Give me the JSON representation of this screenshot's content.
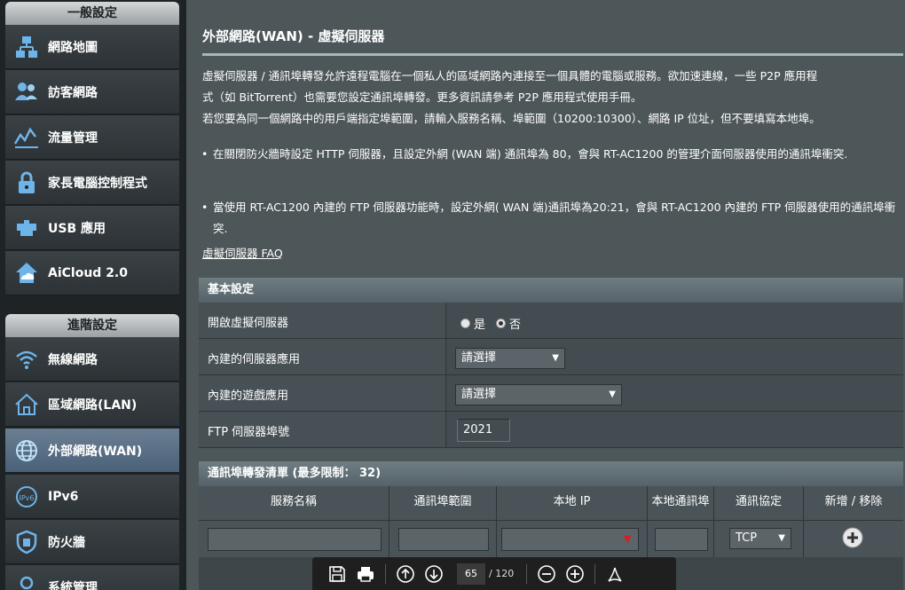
{
  "sidebar": {
    "general_header": "一般設定",
    "advanced_header": "進階設定",
    "general_items": [
      {
        "label": "網路地圖",
        "icon": "network-map-icon"
      },
      {
        "label": "訪客網路",
        "icon": "guest-network-icon"
      },
      {
        "label": "流量管理",
        "icon": "traffic-manager-icon"
      },
      {
        "label": "家長電腦控制程式",
        "icon": "parental-control-icon"
      },
      {
        "label": "USB 應用",
        "icon": "usb-app-icon"
      },
      {
        "label": "AiCloud 2.0",
        "icon": "aicloud-icon"
      }
    ],
    "advanced_items": [
      {
        "label": "無線網路",
        "icon": "wireless-icon"
      },
      {
        "label": "區域網路(LAN)",
        "icon": "lan-icon"
      },
      {
        "label": "外部網路(WAN)",
        "icon": "wan-icon",
        "active": true
      },
      {
        "label": "IPv6",
        "icon": "ipv6-icon"
      },
      {
        "label": "防火牆",
        "icon": "firewall-icon"
      },
      {
        "label": "系統管理",
        "icon": "admin-icon"
      }
    ]
  },
  "main": {
    "title": "外部網路(WAN) - 虛擬伺服器",
    "intro_line1": "虛擬伺服器 / 通訊埠轉發允許遠程電腦在一個私人的區域網路內連接至一個具體的電腦或服務。欲加速連線，一些 P2P 應用程",
    "intro_line2": "式（如 BitTorrent）也需要您設定通訊埠轉發。更多資訊請參考 P2P 應用程式使用手冊。",
    "intro_line3": "若您要為同一個網路中的用戶端指定埠範圍，請輸入服務名稱、埠範圍（10200:10300）、網路 IP 位址，但不要填寫本地埠。",
    "bullet1": "在關閉防火牆時設定 HTTP 伺服器，且設定外網 (WAN 端) 通訊埠為 80，會與 RT-AC1200 的管理介面伺服器使用的通訊埠衝突.",
    "bullet2": "當使用 RT-AC1200 內建的 FTP 伺服器功能時，設定外網( WAN 端)通訊埠為20:21，會與 RT-AC1200 內建的 FTP 伺服器使用的通訊埠衝突.",
    "faq_link": "虛擬伺服器 FAQ"
  },
  "basic": {
    "header": "基本設定",
    "enable_label": "開啟虛擬伺服器",
    "radio_yes": "是",
    "radio_no": "否",
    "selected": "否",
    "builtin_server_label": "內建的伺服器應用",
    "builtin_server_value": "請選擇",
    "builtin_game_label": "內建的遊戲應用",
    "builtin_game_value": "請選擇",
    "ftp_port_label": "FTP 伺服器埠號",
    "ftp_port_value": "2021"
  },
  "portforward": {
    "header": "通訊埠轉發清單 (最多限制： 32)",
    "columns": [
      "服務名稱",
      "通訊埠範圍",
      "本地 IP",
      "本地通訊埠",
      "通訊協定",
      "新增 / 移除"
    ],
    "protocol_value": "TCP"
  },
  "pdf_toolbar": {
    "page_current": "65",
    "page_total": "/ 120"
  }
}
